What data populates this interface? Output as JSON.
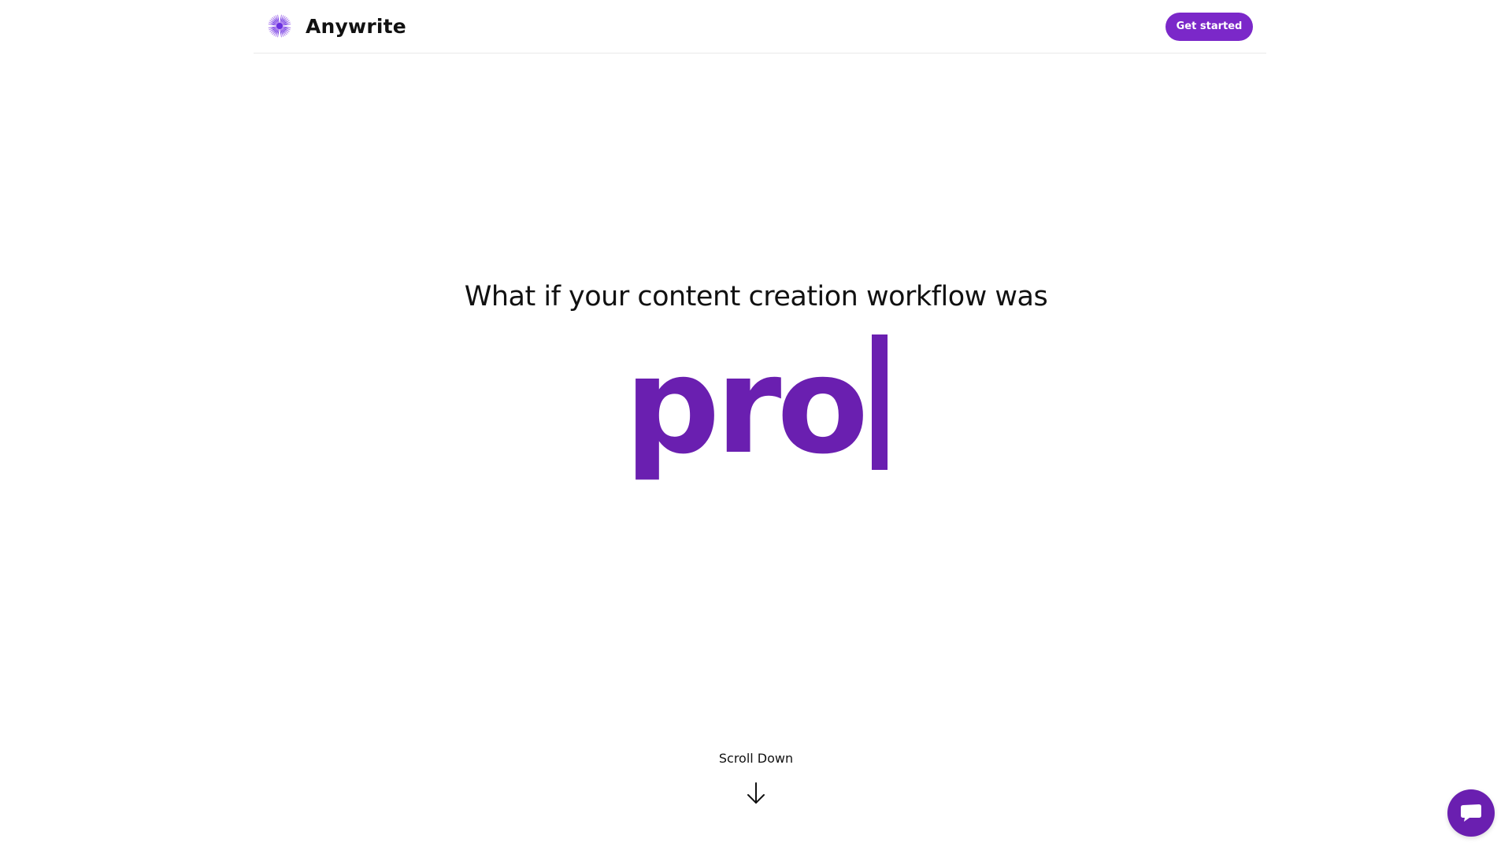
{
  "header": {
    "brand_name": "Anywrite",
    "logo_icon": "starburst-logo-icon",
    "cta_label": "Get started"
  },
  "hero": {
    "heading": "What if your content creation workflow was",
    "typed_word": "pro",
    "caret_icon": "text-caret-icon"
  },
  "scroll_hint": {
    "label": "Scroll Down",
    "icon": "arrow-down-icon"
  },
  "chat_widget": {
    "icon": "chat-bubble-icon"
  },
  "colors": {
    "accent": "#7b28c9",
    "typed_text": "#6a1fb0",
    "text": "#111111",
    "background": "#ffffff",
    "divider": "#e9e9e9"
  }
}
